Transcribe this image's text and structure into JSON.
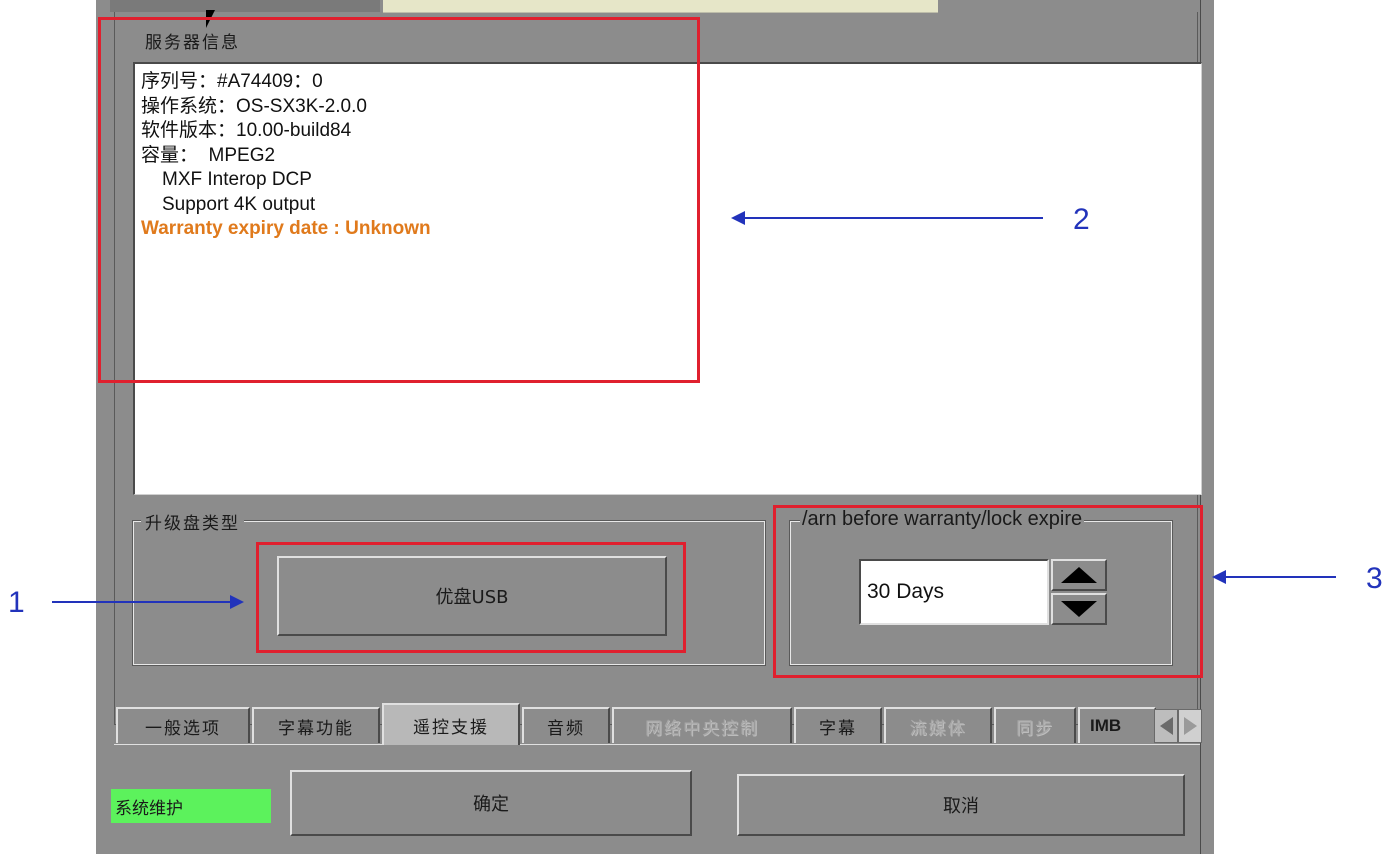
{
  "server_info": {
    "title": "服务器信息",
    "lines": [
      "序列号：#A74409：0",
      "操作系统：OS-SX3K-2.0.0",
      "软件版本：10.00-build84",
      "容量：  MPEG2",
      "MXF Interop DCP",
      "Support 4K output"
    ],
    "warranty_line": "Warranty expiry date : Unknown",
    "warranty_color": "#e07a1c"
  },
  "upgrade_group": {
    "legend": "升级盘类型",
    "button_label": "优盘USB"
  },
  "warn_group": {
    "legend": "/arn before warranty/lock expire",
    "days_value": "30  Days"
  },
  "tabs": [
    {
      "label": "一般选项",
      "state": "normal"
    },
    {
      "label": "字幕功能",
      "state": "normal"
    },
    {
      "label": "遥控支援",
      "state": "active"
    },
    {
      "label": "音频",
      "state": "normal"
    },
    {
      "label": "网络中央控制",
      "state": "disabled"
    },
    {
      "label": "字幕",
      "state": "normal"
    },
    {
      "label": "流媒体",
      "state": "disabled"
    },
    {
      "label": "同步",
      "state": "disabled"
    },
    {
      "label": "IMB",
      "state": "normal"
    }
  ],
  "footer": {
    "status_label": "系统维护",
    "status_color": "#5cf25c",
    "ok_label": "确定",
    "cancel_label": "取消"
  },
  "annotations": [
    "1",
    "2",
    "3"
  ]
}
